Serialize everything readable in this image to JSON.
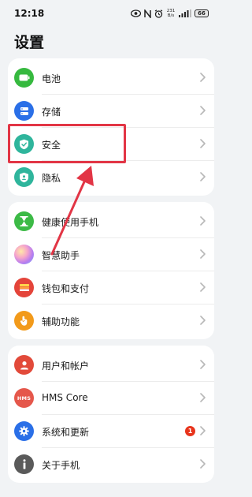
{
  "status_bar": {
    "time": "12:18",
    "net_speed_value": "231",
    "net_speed_unit": "B/s",
    "signal": "ıll",
    "battery": "66"
  },
  "title": "设置",
  "groups": [
    {
      "items": [
        {
          "label": "电池",
          "icon": "battery-icon",
          "icon_color": "#36b93f"
        },
        {
          "label": "存储",
          "icon": "storage-icon",
          "icon_color": "#2a6fe7"
        },
        {
          "label": "安全",
          "icon": "shield-check-icon",
          "icon_color": "#2fb59c"
        },
        {
          "label": "隐私",
          "icon": "privacy-shield-icon",
          "icon_color": "#2fb59c"
        }
      ]
    },
    {
      "items": [
        {
          "label": "健康使用手机",
          "icon": "hourglass-icon",
          "icon_color": "#3cba46"
        },
        {
          "label": "智慧助手",
          "icon": "assistant-orb-icon",
          "icon_color": "#b77cf0"
        },
        {
          "label": "钱包和支付",
          "icon": "wallet-icon",
          "icon_color": "#e4443a"
        },
        {
          "label": "辅助功能",
          "icon": "hand-icon",
          "icon_color": "#f29a1a"
        }
      ]
    },
    {
      "items": [
        {
          "label": "用户和帐户",
          "icon": "user-icon",
          "icon_color": "#e24a3a"
        },
        {
          "label": "HMS Core",
          "icon": "hms-icon",
          "icon_color": "#e5574b",
          "icon_text": "HMS"
        },
        {
          "label": "系统和更新",
          "icon": "gear-icon",
          "icon_color": "#2a6fe7",
          "badge": "1"
        },
        {
          "label": "关于手机",
          "icon": "info-icon",
          "icon_color": "#5a5a5a"
        }
      ]
    }
  ],
  "annotation": {
    "color": "#e23545"
  }
}
